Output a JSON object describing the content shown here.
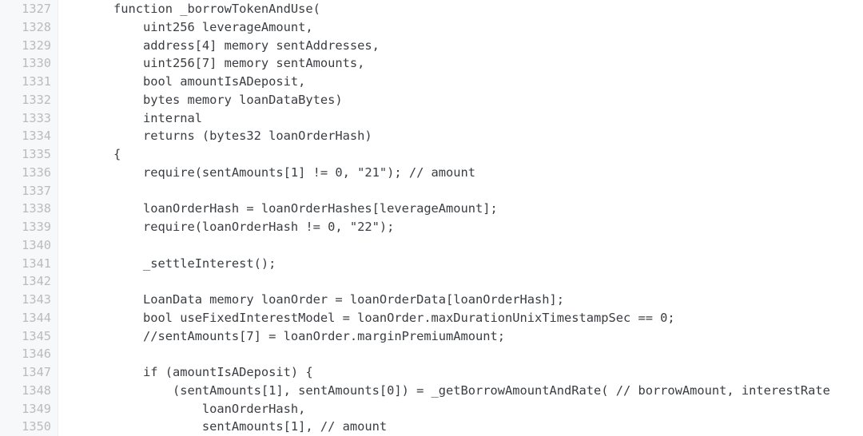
{
  "editor": {
    "language": "solidity",
    "gutter_bg_color": "#f7f8f9",
    "gutter_border_color": "#eceef0",
    "line_number_color": "#b9bbbe",
    "code_text_color": "#3a3d41",
    "background_color": "#ffffff",
    "first_line_number": 1327,
    "last_line_number": 1350,
    "visible_line_count": 24
  },
  "lines": [
    {
      "number": "1327",
      "text": "    function _borrowTokenAndUse("
    },
    {
      "number": "1328",
      "text": "        uint256 leverageAmount,"
    },
    {
      "number": "1329",
      "text": "        address[4] memory sentAddresses,"
    },
    {
      "number": "1330",
      "text": "        uint256[7] memory sentAmounts,"
    },
    {
      "number": "1331",
      "text": "        bool amountIsADeposit,"
    },
    {
      "number": "1332",
      "text": "        bytes memory loanDataBytes)"
    },
    {
      "number": "1333",
      "text": "        internal"
    },
    {
      "number": "1334",
      "text": "        returns (bytes32 loanOrderHash)"
    },
    {
      "number": "1335",
      "text": "    {"
    },
    {
      "number": "1336",
      "text": "        require(sentAmounts[1] != 0, \"21\"); // amount"
    },
    {
      "number": "1337",
      "text": ""
    },
    {
      "number": "1338",
      "text": "        loanOrderHash = loanOrderHashes[leverageAmount];"
    },
    {
      "number": "1339",
      "text": "        require(loanOrderHash != 0, \"22\");"
    },
    {
      "number": "1340",
      "text": ""
    },
    {
      "number": "1341",
      "text": "        _settleInterest();"
    },
    {
      "number": "1342",
      "text": ""
    },
    {
      "number": "1343",
      "text": "        LoanData memory loanOrder = loanOrderData[loanOrderHash];"
    },
    {
      "number": "1344",
      "text": "        bool useFixedInterestModel = loanOrder.maxDurationUnixTimestampSec == 0;"
    },
    {
      "number": "1345",
      "text": "        //sentAmounts[7] = loanOrder.marginPremiumAmount;"
    },
    {
      "number": "1346",
      "text": ""
    },
    {
      "number": "1347",
      "text": "        if (amountIsADeposit) {"
    },
    {
      "number": "1348",
      "text": "            (sentAmounts[1], sentAmounts[0]) = _getBorrowAmountAndRate( // borrowAmount, interestRate"
    },
    {
      "number": "1349",
      "text": "                loanOrderHash,"
    },
    {
      "number": "1350",
      "text": "                sentAmounts[1], // amount"
    }
  ]
}
